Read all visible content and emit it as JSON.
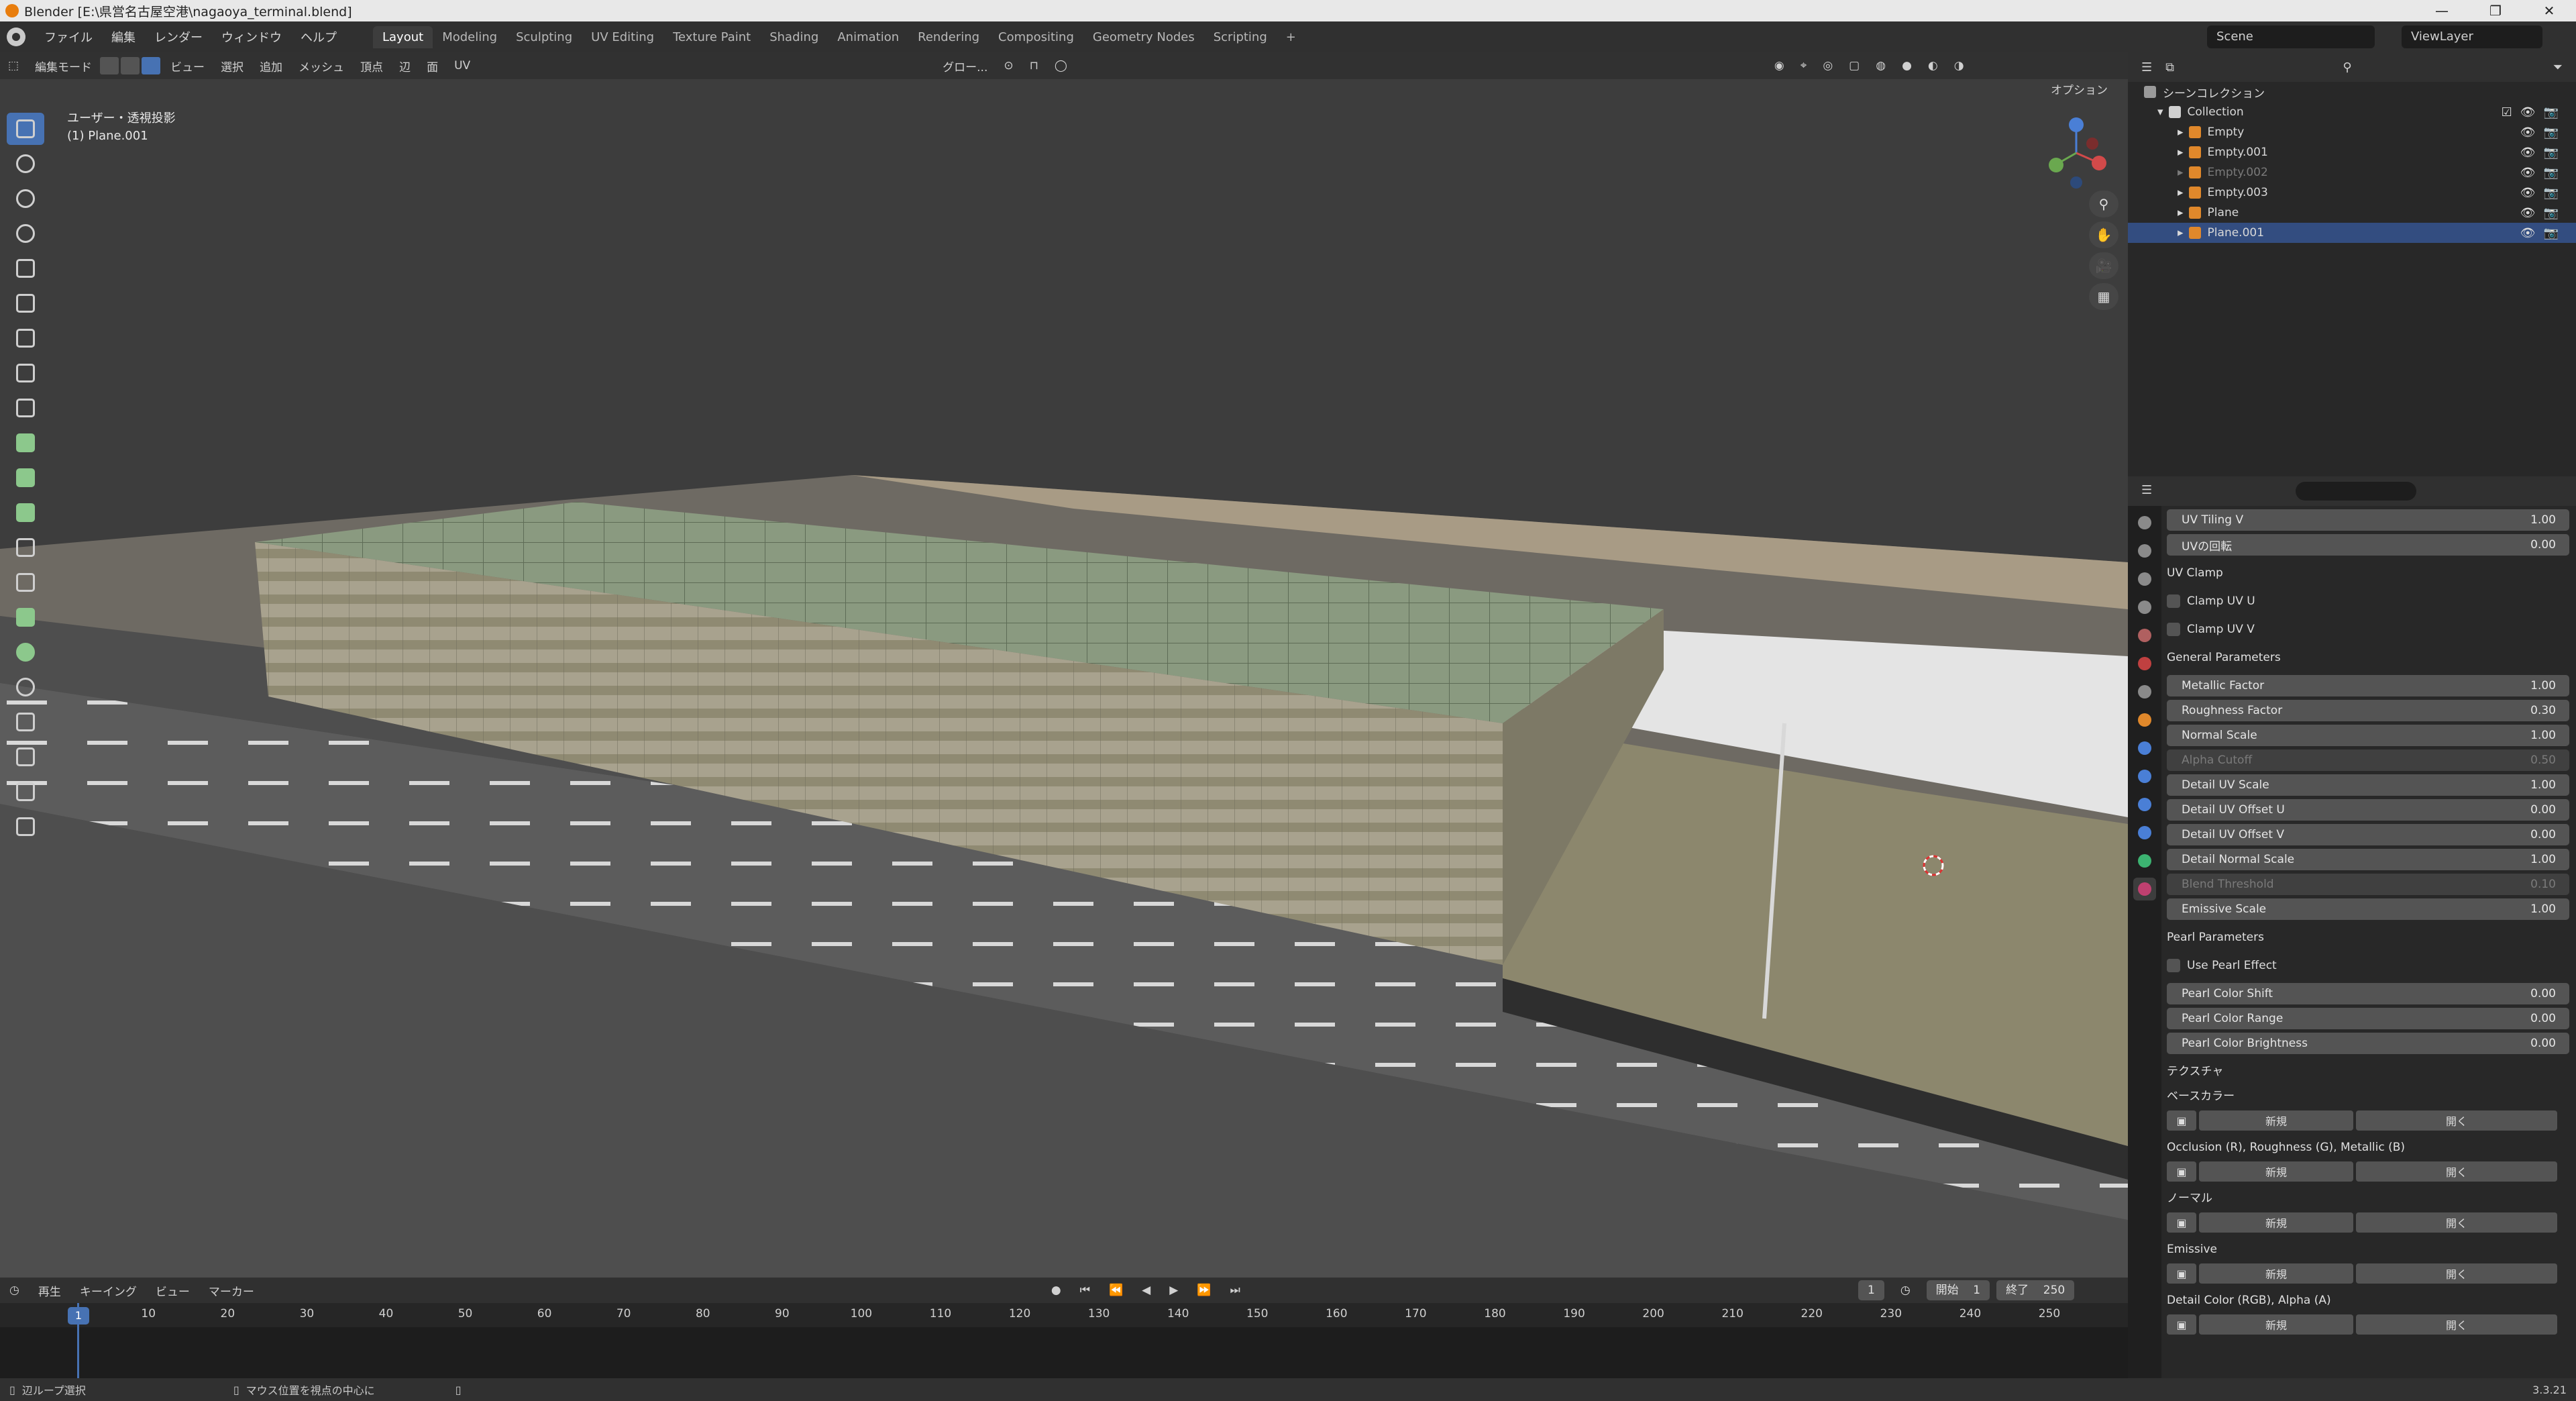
{
  "window": {
    "title": "Blender [E:\\県営名古屋空港\\nagaoya_terminal.blend]",
    "controls": [
      "—",
      "❐",
      "✕"
    ]
  },
  "menu": [
    "ファイル",
    "編集",
    "レンダー",
    "ウィンドウ",
    "ヘルプ"
  ],
  "workspaces": [
    "Layout",
    "Modeling",
    "Sculpting",
    "UV Editing",
    "Texture Paint",
    "Shading",
    "Animation",
    "Rendering",
    "Compositing",
    "Geometry Nodes",
    "Scripting"
  ],
  "active_workspace": "Layout",
  "scene_name": "Scene",
  "view_layer": "ViewLayer",
  "viewport": {
    "mode": "編集モード",
    "menus": [
      "ビュー",
      "選択",
      "追加",
      "メッシュ",
      "頂点",
      "辺",
      "面",
      "UV"
    ],
    "transform": "グロー...",
    "options": "オプション",
    "info_line1": "ユーザー・透視投影",
    "info_line2": "(1) Plane.001",
    "gizmo_axes": [
      "X",
      "Y",
      "Z"
    ]
  },
  "outliner": {
    "root": "シーンコレクション",
    "collection": "Collection",
    "items": [
      {
        "name": "Empty",
        "type": "empty",
        "selected": false,
        "hidden": false
      },
      {
        "name": "Empty.001",
        "type": "empty",
        "selected": false,
        "hidden": false
      },
      {
        "name": "Empty.002",
        "type": "empty",
        "selected": false,
        "hidden": true
      },
      {
        "name": "Empty.003",
        "type": "empty",
        "selected": false,
        "hidden": false
      },
      {
        "name": "Plane",
        "type": "mesh",
        "selected": false,
        "hidden": false
      },
      {
        "name": "Plane.001",
        "type": "mesh",
        "selected": true,
        "hidden": false
      }
    ]
  },
  "properties": {
    "fields_top": [
      {
        "label": "UV Tiling V",
        "value": "1.00"
      },
      {
        "label": "UVの回転",
        "value": "0.00"
      }
    ],
    "uv_clamp": {
      "title": "UV Clamp",
      "checks": [
        "Clamp UV U",
        "Clamp UV V"
      ]
    },
    "general": {
      "title": "General Parameters",
      "fields": [
        {
          "label": "Metallic Factor",
          "value": "1.00",
          "disabled": false
        },
        {
          "label": "Roughness Factor",
          "value": "0.30",
          "disabled": false
        },
        {
          "label": "Normal Scale",
          "value": "1.00",
          "disabled": false
        },
        {
          "label": "Alpha Cutoff",
          "value": "0.50",
          "disabled": true
        },
        {
          "label": "Detail UV Scale",
          "value": "1.00",
          "disabled": false
        },
        {
          "label": "Detail UV Offset U",
          "value": "0.00",
          "disabled": false
        },
        {
          "label": "Detail UV Offset V",
          "value": "0.00",
          "disabled": false
        },
        {
          "label": "Detail Normal Scale",
          "value": "1.00",
          "disabled": false
        },
        {
          "label": "Blend Threshold",
          "value": "0.10",
          "disabled": true
        },
        {
          "label": "Emissive Scale",
          "value": "1.00",
          "disabled": false
        }
      ]
    },
    "pearl": {
      "title": "Pearl Parameters",
      "check": "Use Pearl Effect",
      "fields": [
        {
          "label": "Pearl Color Shift",
          "value": "0.00"
        },
        {
          "label": "Pearl Color Range",
          "value": "0.00"
        },
        {
          "label": "Pearl Color Brightness",
          "value": "0.00"
        }
      ]
    },
    "textures": {
      "title": "テクスチャ",
      "slots": [
        "ベースカラー",
        "Occlusion (R), Roughness (G), Metallic (B)",
        "ノーマル",
        "Emissive",
        "Detail Color (RGB), Alpha (A)"
      ],
      "new_label": "新規",
      "open_label": "開く"
    }
  },
  "timeline": {
    "menus": [
      "再生",
      "キーイング",
      "ビュー",
      "マーカー"
    ],
    "current_frame": "1",
    "start_label": "開始",
    "start": "1",
    "end_label": "終了",
    "end": "250",
    "ticks": [
      "1",
      "10",
      "20",
      "30",
      "40",
      "50",
      "60",
      "70",
      "80",
      "90",
      "100",
      "110",
      "120",
      "130",
      "140",
      "150",
      "160",
      "170",
      "180",
      "190",
      "200",
      "210",
      "220",
      "230",
      "240",
      "250"
    ]
  },
  "status": {
    "left": "辺ループ選択",
    "middle": "マウス位置を視点の中心に",
    "version": "3.3.21"
  }
}
